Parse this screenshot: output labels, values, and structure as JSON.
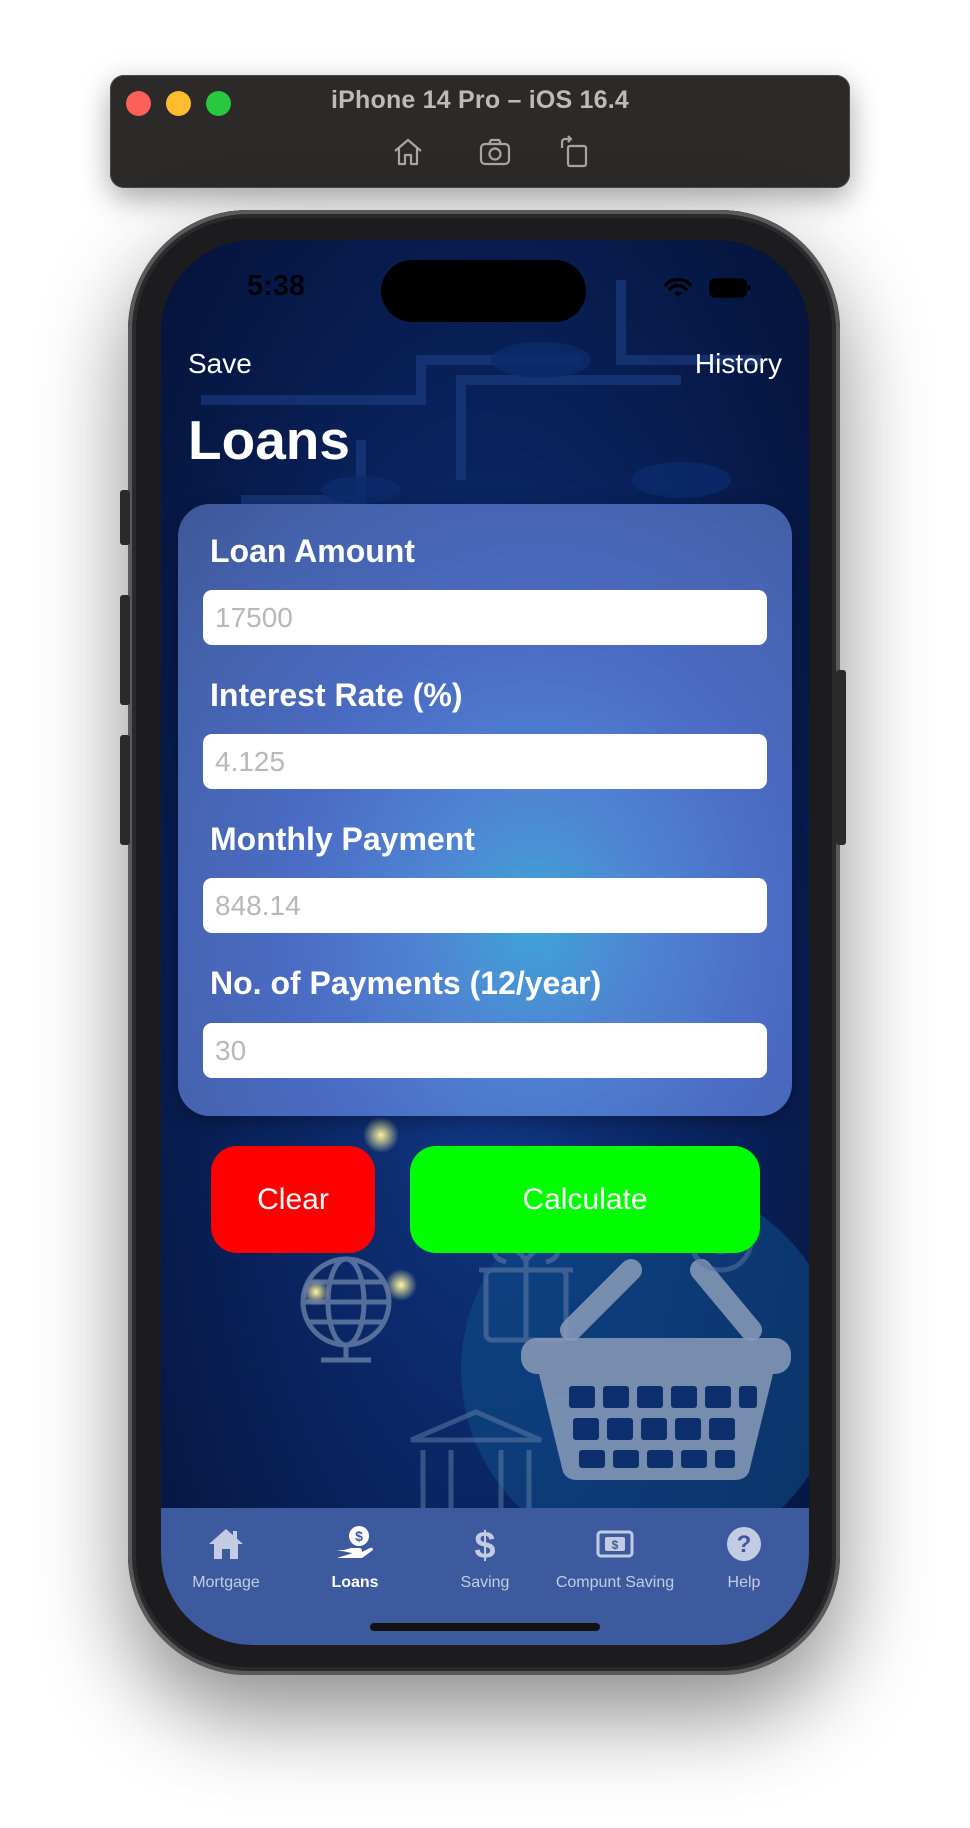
{
  "simulator": {
    "title": "iPhone 14 Pro – iOS 16.4",
    "tools": [
      "home-icon",
      "screenshot-icon",
      "rotate-icon"
    ]
  },
  "status_bar": {
    "time": "5:38",
    "icons": [
      "wifi-icon",
      "battery-icon"
    ]
  },
  "nav": {
    "left_label": "Save",
    "right_label": "History",
    "title": "Loans"
  },
  "form": {
    "fields": [
      {
        "label": "Loan Amount",
        "placeholder": "17500"
      },
      {
        "label": "Interest Rate (%)",
        "placeholder": "4.125"
      },
      {
        "label": "Monthly Payment",
        "placeholder": "848.14"
      },
      {
        "label": "No. of Payments (12/year)",
        "placeholder": "30"
      }
    ]
  },
  "buttons": {
    "clear_label": "Clear",
    "calculate_label": "Calculate",
    "clear_color": "#fe0000",
    "calculate_color": "#00fe00"
  },
  "tabbar": {
    "items": [
      {
        "label": "Mortgage",
        "icon": "house-icon",
        "active": false
      },
      {
        "label": "Loans",
        "icon": "hand-dollar-icon",
        "active": true
      },
      {
        "label": "Saving",
        "icon": "dollar-icon",
        "active": false
      },
      {
        "label": "Compunt Saving",
        "icon": "banknote-icon",
        "active": false
      },
      {
        "label": "Help",
        "icon": "question-icon",
        "active": false
      }
    ]
  },
  "colors": {
    "accent_active": "#ffffff",
    "tab_inactive": "#c4cce4",
    "tabbar_bg": "#3e5a9f"
  }
}
